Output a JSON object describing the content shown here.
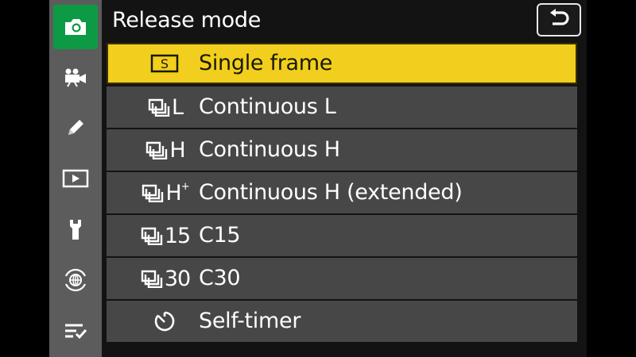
{
  "header": {
    "title": "Release mode",
    "back_icon": "return-arrow-icon"
  },
  "sidebar": {
    "items": [
      {
        "name": "photo-shooting-menu",
        "icon": "camera-icon",
        "active": true
      },
      {
        "name": "movie-recording-menu",
        "icon": "movie-camera-icon"
      },
      {
        "name": "custom-settings-menu",
        "icon": "pencil-icon"
      },
      {
        "name": "playback-menu",
        "icon": "playback-icon"
      },
      {
        "name": "setup-menu",
        "icon": "wrench-icon"
      },
      {
        "name": "network-menu",
        "icon": "network-icon"
      },
      {
        "name": "my-menu",
        "icon": "my-menu-icon"
      }
    ]
  },
  "menu": {
    "items": [
      {
        "icon_text": "S",
        "label": "Single frame",
        "selected": true
      },
      {
        "icon_text": "L",
        "label": "Continuous L"
      },
      {
        "icon_text": "H",
        "label": "Continuous H"
      },
      {
        "icon_text": "H",
        "icon_sup": "+",
        "label": "Continuous H (extended)"
      },
      {
        "icon_text": "15",
        "label": "C15"
      },
      {
        "icon_text": "30",
        "label": "C30"
      },
      {
        "icon_text": "",
        "label": "Self-timer"
      }
    ]
  },
  "colors": {
    "selected_bg": "#f2cf1e",
    "active_tab": "#0d9a45",
    "row_bg": "#474747"
  }
}
